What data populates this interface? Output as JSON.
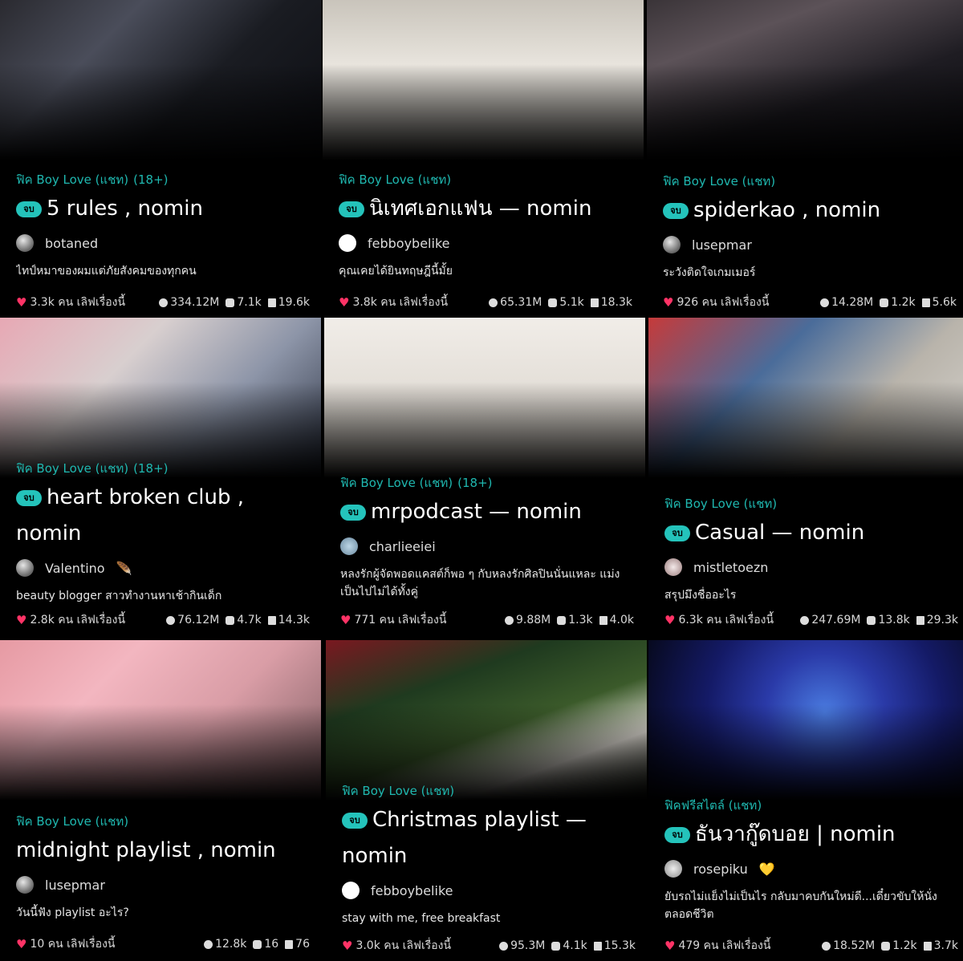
{
  "cards": [
    {
      "genre": "ฟิค Boy Love (แชท)",
      "rating": "(18+)",
      "badge": "จบ",
      "title": "5 rules , nomin",
      "author": "botaned",
      "author_badge": "",
      "desc": "ไทป์หมาของผมแต่ภัยสังคมของทุกคน",
      "likes": "3.3k คน เลิฟเรื่องนี้",
      "views": "334.12M",
      "comments": "7.1k",
      "chapters": "19.6k"
    },
    {
      "genre": "ฟิค Boy Love (แชท)",
      "rating": "",
      "badge": "จบ",
      "title": "นิเทศเอกแฟน — nomin",
      "author": "febboybelike",
      "author_badge": "",
      "desc": "คุณเคยได้ยินทฤษฎีนี้มั้ย",
      "likes": "3.8k คน เลิฟเรื่องนี้",
      "views": "65.31M",
      "comments": "5.1k",
      "chapters": "18.3k"
    },
    {
      "genre": "ฟิค Boy Love (แชท)",
      "rating": "",
      "badge": "จบ",
      "title": "spiderkao , nomin",
      "author": "lusepmar",
      "author_badge": "",
      "desc": "ระวังติดใจเกมเมอร์",
      "likes": "926 คน เลิฟเรื่องนี้",
      "views": "14.28M",
      "comments": "1.2k",
      "chapters": "5.6k"
    },
    {
      "genre": "ฟิค Boy Love (แชท)",
      "rating": "(18+)",
      "badge": "จบ",
      "title": "heart broken club , nomin",
      "author": "Valentino",
      "author_badge": "🪶",
      "desc": "beauty blogger สาวทำงานหาเช้ากินเด็ก",
      "likes": "2.8k คน เลิฟเรื่องนี้",
      "views": "76.12M",
      "comments": "4.7k",
      "chapters": "14.3k"
    },
    {
      "genre": "ฟิค Boy Love (แชท)",
      "rating": "(18+)",
      "badge": "จบ",
      "title": "mrpodcast — nomin",
      "author": "charlieeiei",
      "author_badge": "",
      "desc": "หลงรักผู้จัดพอดแคสต์ก็พอ ๆ กับหลงรักศิลปินนั่นแหละ แม่งเป็นไปไม่ได้ทั้งคู่",
      "likes": "771 คน เลิฟเรื่องนี้",
      "views": "9.88M",
      "comments": "1.3k",
      "chapters": "4.0k"
    },
    {
      "genre": "ฟิค Boy Love (แชท)",
      "rating": "",
      "badge": "จบ",
      "title": "Casual — nomin",
      "author": "mistletoezn",
      "author_badge": "",
      "desc": "สรุปมึงชื่ออะไร",
      "likes": "6.3k คน เลิฟเรื่องนี้",
      "views": "247.69M",
      "comments": "13.8k",
      "chapters": "29.3k"
    },
    {
      "genre": "ฟิค Boy Love (แชท)",
      "rating": "",
      "badge": "",
      "title": "midnight playlist , nomin",
      "author": "lusepmar",
      "author_badge": "",
      "desc": "วันนี้ฟัง playlist อะไร?",
      "likes": "10 คน เลิฟเรื่องนี้",
      "views": "12.8k",
      "comments": "16",
      "chapters": "76"
    },
    {
      "genre": "ฟิค Boy Love (แชท)",
      "rating": "",
      "badge": "จบ",
      "title": "Christmas playlist — nomin",
      "author": "febboybelike",
      "author_badge": "",
      "desc": "stay with me, free breakfast",
      "likes": "3.0k คน เลิฟเรื่องนี้",
      "views": "95.3M",
      "comments": "4.1k",
      "chapters": "15.3k"
    },
    {
      "genre": "ฟิคฟรีสไตล์ (แชท)",
      "rating": "",
      "badge": "จบ",
      "title": "ธันวากู๊ดบอย | nomin",
      "author": "rosepiku",
      "author_badge": "💛",
      "desc": "ยับรถไม่แย็งไม่เป็นไร กลับมาคบกันใหม่ดี...เดี๋ยวขับให้นั่งตลอดชีวิต",
      "likes": "479 คน เลิฟเรื่องนี้",
      "views": "18.52M",
      "comments": "1.2k",
      "chapters": "3.7k"
    }
  ]
}
